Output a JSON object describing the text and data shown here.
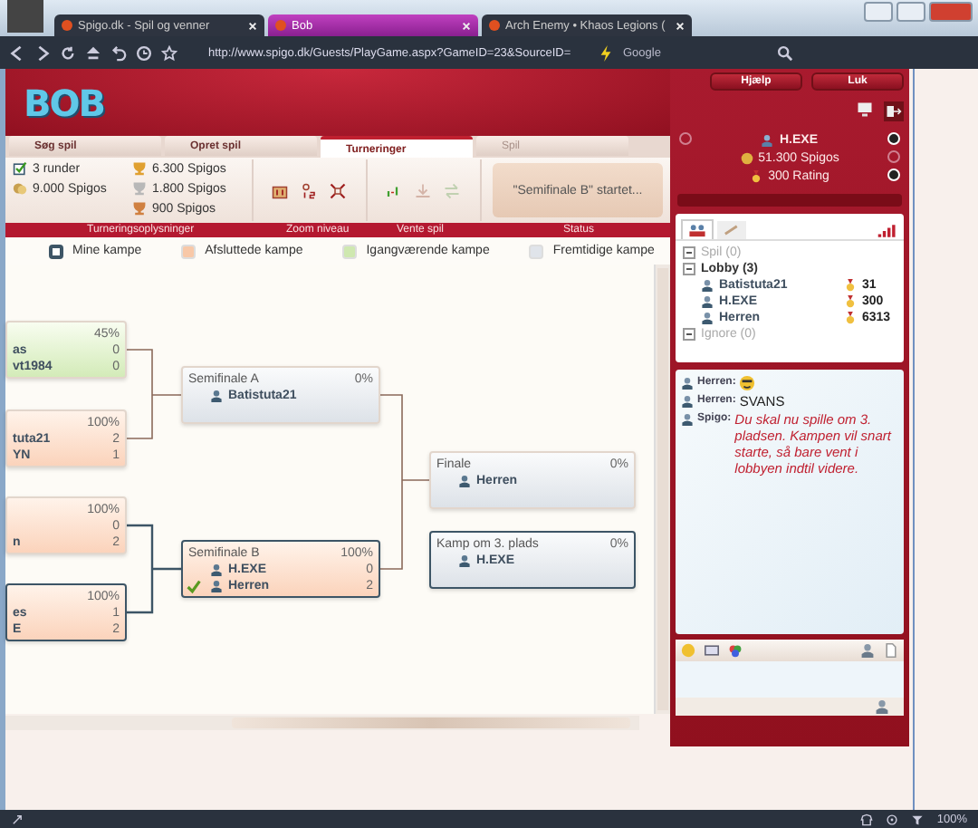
{
  "browser": {
    "tabs": [
      {
        "label": "Spigo.dk - Spil og venner",
        "selected": false
      },
      {
        "label": "Bob",
        "selected": true
      },
      {
        "label": "Arch Enemy • Khaos Legions (",
        "selected": false
      }
    ],
    "url": "http://www.spigo.dk/Guests/PlayGame.aspx?GameID=23&SourceID=",
    "search_placeholder": "Google",
    "zoom": "100%"
  },
  "header": {
    "logo": "BOB",
    "buttons": [
      "Hjælp",
      "Luk"
    ]
  },
  "game_tabs": [
    {
      "label": "Søg spil",
      "selected": false,
      "disabled": false
    },
    {
      "label": "Opret spil",
      "selected": false,
      "disabled": false
    },
    {
      "label": "Turneringer",
      "selected": true,
      "disabled": false
    },
    {
      "label": "Spil",
      "selected": false,
      "disabled": true
    }
  ],
  "tournament_info": {
    "rounds": "3 runder",
    "pot": "9.000 Spigos",
    "prizes": [
      {
        "amount": "6.300 Spigos",
        "color": "#e0a030"
      },
      {
        "amount": "1.800 Spigos",
        "color": "#b8b8b8"
      },
      {
        "amount": "900 Spigos",
        "color": "#d08040"
      }
    ],
    "status": "\"Semifinale B\" startet..."
  },
  "section_labels": [
    "Turneringsoplysninger",
    "Zoom niveau",
    "Vente spil",
    "Status"
  ],
  "legend": [
    {
      "label": "Mine kampe",
      "kind": "outline",
      "color": "#3d5566"
    },
    {
      "label": "Afsluttede kampe",
      "kind": "fill",
      "color": "#f8c8a8"
    },
    {
      "label": "Igangværende kampe",
      "kind": "fill",
      "color": "#cfe8b0"
    },
    {
      "label": "Fremtidige kampe",
      "kind": "fill",
      "color": "#e0e4ea"
    }
  ],
  "matches": [
    {
      "kind": "ongoing",
      "mine": false,
      "percent": "45%",
      "players": [
        {
          "name": "as",
          "score": "0",
          "winner": false
        },
        {
          "name": "vt1984",
          "score": "0",
          "winner": false
        }
      ]
    },
    {
      "kind": "finished",
      "mine": false,
      "percent": "100%",
      "players": [
        {
          "name": "tuta21",
          "score": "2",
          "winner": false
        },
        {
          "name": "YN",
          "score": "1",
          "winner": false
        }
      ]
    },
    {
      "kind": "finished",
      "mine": false,
      "percent": "100%",
      "players": [
        {
          "score": "0",
          "winner": false
        },
        {
          "name": "n",
          "score": "2",
          "winner": false
        }
      ]
    },
    {
      "kind": "finished",
      "mine": true,
      "percent": "100%",
      "players": [
        {
          "name": "es",
          "score": "1",
          "winner": false
        },
        {
          "name": "E",
          "score": "2",
          "winner": false
        }
      ]
    },
    {
      "title": "Semifinale A",
      "kind": "future",
      "mine": false,
      "percent": "0%",
      "players": [
        {
          "name": "Batistuta21",
          "winner": false
        }
      ]
    },
    {
      "title": "Semifinale B",
      "kind": "finished",
      "mine": true,
      "percent": "100%",
      "players": [
        {
          "name": "H.EXE",
          "score": "0",
          "winner": false
        },
        {
          "name": "Herren",
          "score": "2",
          "winner": true
        }
      ]
    },
    {
      "title": "Finale",
      "kind": "future",
      "mine": false,
      "percent": "0%",
      "players": [
        {
          "name": "Herren",
          "winner": false
        }
      ]
    },
    {
      "title": "Kamp om 3. plads",
      "kind": "future",
      "mine": true,
      "percent": "0%",
      "players": [
        {
          "name": "H.EXE",
          "winner": false
        }
      ]
    }
  ],
  "user": {
    "name": "H.EXE",
    "spigos": "51.300 Spigos",
    "rating": "300 Rating"
  },
  "lobby_tabs": [
    {
      "selected": true
    },
    {
      "selected": false
    }
  ],
  "lobby_tree": [
    {
      "label": "Spil (0)",
      "disabled": true
    },
    {
      "label": "Lobby (3)",
      "disabled": false,
      "children": [
        {
          "name": "Batistuta21",
          "rating": "31"
        },
        {
          "name": "H.EXE",
          "rating": "300"
        },
        {
          "name": "Herren",
          "rating": "6313"
        }
      ]
    },
    {
      "label": "Ignore (0)",
      "disabled": true
    }
  ],
  "chat": [
    {
      "sender": "Herren:",
      "kind": "emoticon"
    },
    {
      "sender": "Herren:",
      "kind": "text",
      "text": "SVANS"
    },
    {
      "sender": "Spigo:",
      "kind": "system",
      "text": "Du skal nu spille om 3. pladsen. Kampen vil snart starte, så bare vent i lobbyen indtil videre."
    }
  ]
}
